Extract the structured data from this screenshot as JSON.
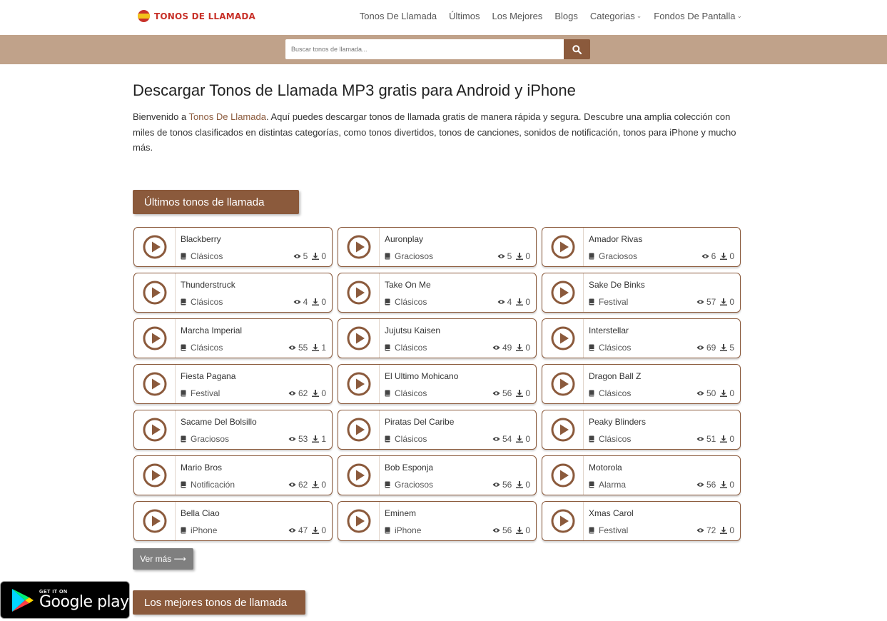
{
  "header": {
    "logo_text": "TONOS DE LLAMADA",
    "nav": [
      {
        "label": "Tonos De Llamada",
        "dropdown": false
      },
      {
        "label": "Últimos",
        "dropdown": false
      },
      {
        "label": "Los Mejores",
        "dropdown": false
      },
      {
        "label": "Blogs",
        "dropdown": false
      },
      {
        "label": "Categorias",
        "dropdown": true
      },
      {
        "label": "Fondos De Pantalla",
        "dropdown": true
      }
    ]
  },
  "search": {
    "placeholder": "Buscar tonos de llamada..."
  },
  "main": {
    "title": "Descargar Tonos de Llamada MP3 gratis para Android y iPhone",
    "intro_prefix": "Bienvenido a ",
    "intro_link": "Tonos De Llamada",
    "intro_suffix": ". Aquí puedes descargar tonos de llamada gratis de manera rápida y segura. Descubre una amplia colección con miles de tonos clasificados en distintas categorías, como tonos divertidos, tonos de canciones, sonidos de notificación, tonos para iPhone y mucho más.",
    "section_latest": "Últimos tonos de llamada",
    "more_label": "Ver más ⟶",
    "section_best": "Los mejores tonos de llamada"
  },
  "ringtones": [
    {
      "title": "Blackberry",
      "category": "Clásicos",
      "views": "5",
      "downloads": "0"
    },
    {
      "title": "Auronplay",
      "category": "Graciosos",
      "views": "5",
      "downloads": "0"
    },
    {
      "title": "Amador Rivas",
      "category": "Graciosos",
      "views": "6",
      "downloads": "0"
    },
    {
      "title": "Thunderstruck",
      "category": "Clásicos",
      "views": "4",
      "downloads": "0"
    },
    {
      "title": "Take On Me",
      "category": "Clásicos",
      "views": "4",
      "downloads": "0"
    },
    {
      "title": "Sake De Binks",
      "category": "Festival",
      "views": "57",
      "downloads": "0"
    },
    {
      "title": "Marcha Imperial",
      "category": "Clásicos",
      "views": "55",
      "downloads": "1"
    },
    {
      "title": "Jujutsu Kaisen",
      "category": "Clásicos",
      "views": "49",
      "downloads": "0"
    },
    {
      "title": "Interstellar",
      "category": "Clásicos",
      "views": "69",
      "downloads": "5"
    },
    {
      "title": "Fiesta Pagana",
      "category": "Festival",
      "views": "62",
      "downloads": "0"
    },
    {
      "title": "El Ultimo Mohicano",
      "category": "Clásicos",
      "views": "56",
      "downloads": "0"
    },
    {
      "title": "Dragon Ball Z",
      "category": "Clásicos",
      "views": "50",
      "downloads": "0"
    },
    {
      "title": "Sacame Del Bolsillo",
      "category": "Graciosos",
      "views": "53",
      "downloads": "1"
    },
    {
      "title": "Piratas Del Caribe",
      "category": "Clásicos",
      "views": "54",
      "downloads": "0"
    },
    {
      "title": "Peaky Blinders",
      "category": "Clásicos",
      "views": "51",
      "downloads": "0"
    },
    {
      "title": "Mario Bros",
      "category": "Notificación",
      "views": "62",
      "downloads": "0"
    },
    {
      "title": "Bob Esponja",
      "category": "Graciosos",
      "views": "56",
      "downloads": "0"
    },
    {
      "title": "Motorola",
      "category": "Alarma",
      "views": "56",
      "downloads": "0"
    },
    {
      "title": "Bella Ciao",
      "category": "iPhone",
      "views": "47",
      "downloads": "0"
    },
    {
      "title": "Eminem",
      "category": "iPhone",
      "views": "56",
      "downloads": "0"
    },
    {
      "title": "Xmas Carol",
      "category": "Festival",
      "views": "72",
      "downloads": "0"
    }
  ],
  "badge": {
    "small": "GET IT ON",
    "big": "Google play"
  },
  "colors": {
    "brand": "#8b5a3c",
    "searchbar": "#c0a28a",
    "logo_red": "#c8322a",
    "more_gray": "#7f7f7f"
  },
  "icons": {
    "search": "search-icon",
    "play": "play-circle-icon",
    "category": "book-icon",
    "views": "eye-icon",
    "downloads": "download-icon"
  }
}
